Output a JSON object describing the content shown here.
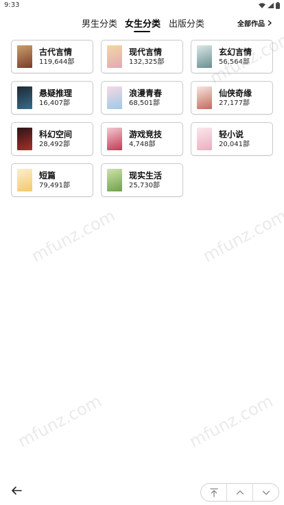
{
  "status_bar": {
    "time": "9:33"
  },
  "tabs": [
    {
      "label": "男生分类"
    },
    {
      "label": "女生分类"
    },
    {
      "label": "出版分类"
    }
  ],
  "all_works": {
    "label": "全部作品"
  },
  "watermark": "mfunz.com",
  "categories": [
    {
      "name": "古代言情",
      "count": "119,644部",
      "cover_colors": [
        "#c9a06a",
        "#7a3b2a"
      ]
    },
    {
      "name": "现代言情",
      "count": "132,325部",
      "cover_colors": [
        "#f3d7a1",
        "#e5a7b8"
      ]
    },
    {
      "name": "玄幻言情",
      "count": "56,564部",
      "cover_colors": [
        "#dbe7e8",
        "#6a8f91"
      ]
    },
    {
      "name": "悬疑推理",
      "count": "16,407部",
      "cover_colors": [
        "#1c2a35",
        "#3a6a8a"
      ]
    },
    {
      "name": "浪漫青春",
      "count": "68,501部",
      "cover_colors": [
        "#f6d9e3",
        "#9ec8e6"
      ]
    },
    {
      "name": "仙侠奇缘",
      "count": "27,177部",
      "cover_colors": [
        "#f5e6df",
        "#c56a5e"
      ]
    },
    {
      "name": "科幻空间",
      "count": "28,492部",
      "cover_colors": [
        "#2a1416",
        "#a8302b"
      ]
    },
    {
      "name": "游戏竞技",
      "count": "4,748部",
      "cover_colors": [
        "#f4c9d2",
        "#c23a55"
      ]
    },
    {
      "name": "轻小说",
      "count": "20,041部",
      "cover_colors": [
        "#fbe7ec",
        "#e9aec0"
      ]
    },
    {
      "name": "短篇",
      "count": "79,491部",
      "cover_colors": [
        "#fbeed0",
        "#f2c96a"
      ]
    },
    {
      "name": "现实生活",
      "count": "25,730部",
      "cover_colors": [
        "#cfe3a8",
        "#6fa04b"
      ]
    }
  ]
}
